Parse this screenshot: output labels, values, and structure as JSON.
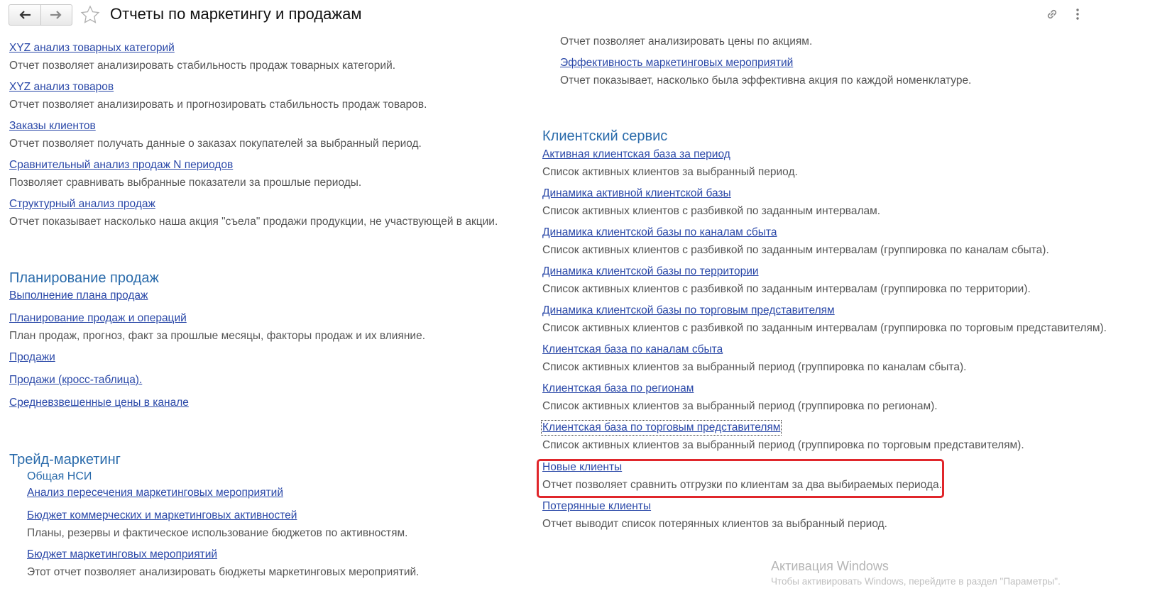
{
  "window": {
    "title": "Отчеты по маркетингу и продажам",
    "icons": [
      "arrow-left-icon",
      "arrow-right-icon",
      "star-icon",
      "link-icon",
      "more-vertical-icon"
    ]
  },
  "left": {
    "top_items": [
      {
        "link": "XYZ анализ товарных категорий",
        "desc": "Отчет позволяет анализировать стабильность продаж товарных категорий."
      },
      {
        "link": "XYZ анализ товаров",
        "desc": "Отчет позволяет анализировать и прогнозировать стабильность продаж товаров."
      },
      {
        "link": "Заказы клиентов",
        "desc": "Отчет позволяет получать данные о заказах покупателей за выбранный период."
      },
      {
        "link": "Сравнительный анализ продаж N периодов",
        "desc": "Позволяет сравнивать выбранные показатели за прошлые периоды."
      },
      {
        "link": "Структурный анализ продаж",
        "desc": "Отчет показывает насколько наша акция \"съела\" продажи продукции, не участвующей в акции."
      }
    ],
    "planning": {
      "title": "Планирование продаж",
      "items": [
        {
          "link": "Выполнение плана продаж"
        },
        {
          "link": "Планирование продаж и операций",
          "desc": "План продаж, прогноз, факт за прошлые месяцы, факторы продаж и их влияние."
        },
        {
          "link": "Продажи"
        },
        {
          "link": "Продажи (кросс-таблица)."
        },
        {
          "link": "Средневзвешенные цены в канале"
        }
      ]
    },
    "trade": {
      "title": "Трейд-маркетинг",
      "subgroup": "Общая НСИ",
      "items": [
        {
          "link": "Анализ пересечения маркетинговых мероприятий"
        },
        {
          "link": "Бюджет коммерческих и маркетинговых активностей",
          "desc": "Планы, резервы и фактическое использование бюджетов по активностям."
        },
        {
          "link": "Бюджет маркетинговых мероприятий",
          "desc": "Этот отчет позволяет анализировать бюджеты маркетинговых мероприятий."
        }
      ]
    }
  },
  "right": {
    "top_desc": "Отчет позволяет анализировать цены по акциям.",
    "top_items": [
      {
        "link": "Эффективность маркетинговых мероприятий",
        "desc": "Отчет показывает, насколько была эффективна акция по каждой номенклатуре."
      }
    ],
    "client_service": {
      "title": "Клиентский сервис",
      "items": [
        {
          "link": "Активная клиентская база за период",
          "desc": "Список активных клиентов за выбранный период."
        },
        {
          "link": "Динамика активной клиентской базы",
          "desc": "Список активных клиентов с разбивкой по заданным интервалам."
        },
        {
          "link": "Динамика клиентской базы по каналам сбыта",
          "desc": "Список активных клиентов с разбивкой по заданным интервалам (группировка по каналам сбыта)."
        },
        {
          "link": "Динамика клиентской базы по территории",
          "desc": "Список активных клиентов с разбивкой по заданным интервалам (группировка по территории)."
        },
        {
          "link": "Динамика клиентской базы по торговым представителям",
          "desc": "Список активных клиентов с разбивкой по заданным интервалам (группировка по торговым представителям)."
        },
        {
          "link": "Клиентская база по каналам сбыта",
          "desc": "Список активных клиентов за выбранный период (группировка по каналам сбыта)."
        },
        {
          "link": "Клиентская база по регионам",
          "desc": "Список активных клиентов за выбранный период (группировка по регионам)."
        },
        {
          "link": "Клиентская база по торговым представителям",
          "desc": "Список активных клиентов за выбранный период (группировка по торговым представителям)."
        },
        {
          "link": "Новые клиенты",
          "desc": "Отчет позволяет сравнить отгрузки по клиентам за два выбираемых периода."
        },
        {
          "link": "Потерянные клиенты",
          "desc": "Отчет выводит список потерянных клиентов за выбранный период."
        }
      ]
    }
  },
  "watermark": {
    "line1": "Активация Windows",
    "line2": "Чтобы активировать Windows, перейдите в раздел \"Параметры\"."
  },
  "colors": {
    "link": "#2a48a8",
    "section": "#2a6bab",
    "description": "#555555",
    "highlight": "#e0262b"
  }
}
